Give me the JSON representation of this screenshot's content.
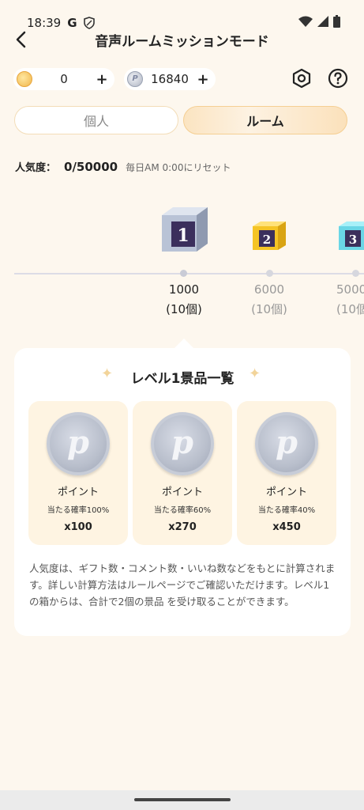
{
  "status_bar": {
    "time": "18:39",
    "g_label": "G"
  },
  "header": {
    "title": "音声ルームミッションモード"
  },
  "currency": {
    "gold_value": "0",
    "silver_value": "16840",
    "silver_symbol": "P",
    "plus_label": "+"
  },
  "tabs": [
    {
      "label": "個人",
      "active": false
    },
    {
      "label": "ルーム",
      "active": true
    }
  ],
  "popularity": {
    "label": "人気度：",
    "value": "0/50000",
    "reset_note": "毎日AM 0:00にリセット"
  },
  "levels": [
    {
      "number": "1",
      "amount": "1000",
      "count": "(10個)"
    },
    {
      "number": "2",
      "amount": "6000",
      "count": "(10個)"
    },
    {
      "number": "3",
      "amount": "5000",
      "count": "(10個"
    }
  ],
  "panel": {
    "title": "レベル1景品一覧",
    "sparkle": "✦",
    "rewards": [
      {
        "name": "ポイント",
        "probability": "当たる確率100%",
        "quantity": "x100",
        "symbol": "p"
      },
      {
        "name": "ポイント",
        "probability": "当たる確率60%",
        "quantity": "x270",
        "symbol": "p"
      },
      {
        "name": "ポイント",
        "probability": "当たる確率40%",
        "quantity": "x450",
        "symbol": "p"
      }
    ],
    "description": "人気度は、ギフト数・コメント数・いいね数などをもとに計算されます。詳しい計算方法はルールページでご確認いただけます。レベル1の箱からは、合計で2個の景品 を受け取ることができます。"
  },
  "colors": {
    "background": "#fdf7ee",
    "accent_tab": "#fbe4c1",
    "card_bg": "#fef4e2",
    "cube1": "#b9c3d6",
    "cube2": "#f5c425",
    "cube3": "#6ad6e6"
  }
}
